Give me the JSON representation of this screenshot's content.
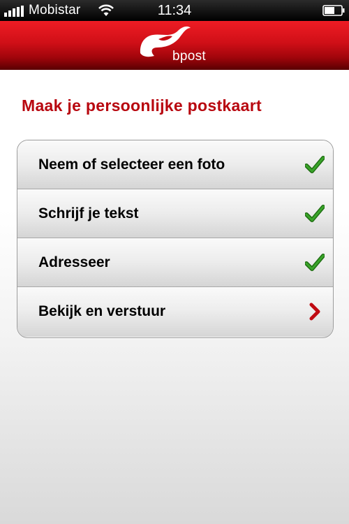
{
  "status_bar": {
    "carrier": "Mobistar",
    "time": "11:34",
    "signal_icon": "signal-bars-icon",
    "wifi_icon": "wifi-icon",
    "battery_icon": "battery-icon"
  },
  "header": {
    "logo_icon": "bpost-horn-logo",
    "logo_text": "bpost",
    "colors": {
      "brand_red": "#d2121a",
      "dark_red": "#5a0002"
    }
  },
  "page_title": "Maak je persoonlijke postkaart",
  "title_color": "#b8070f",
  "steps": [
    {
      "label": "Neem of selecteer een foto",
      "status": "done",
      "icon": "checkmark-icon"
    },
    {
      "label": "Schrijf je tekst",
      "status": "done",
      "icon": "checkmark-icon"
    },
    {
      "label": "Adresseer",
      "status": "done",
      "icon": "checkmark-icon"
    },
    {
      "label": "Bekijk en verstuur",
      "status": "next",
      "icon": "chevron-right-icon"
    }
  ],
  "icon_colors": {
    "check": "#2f8a1f",
    "chevron": "#c00a12"
  }
}
